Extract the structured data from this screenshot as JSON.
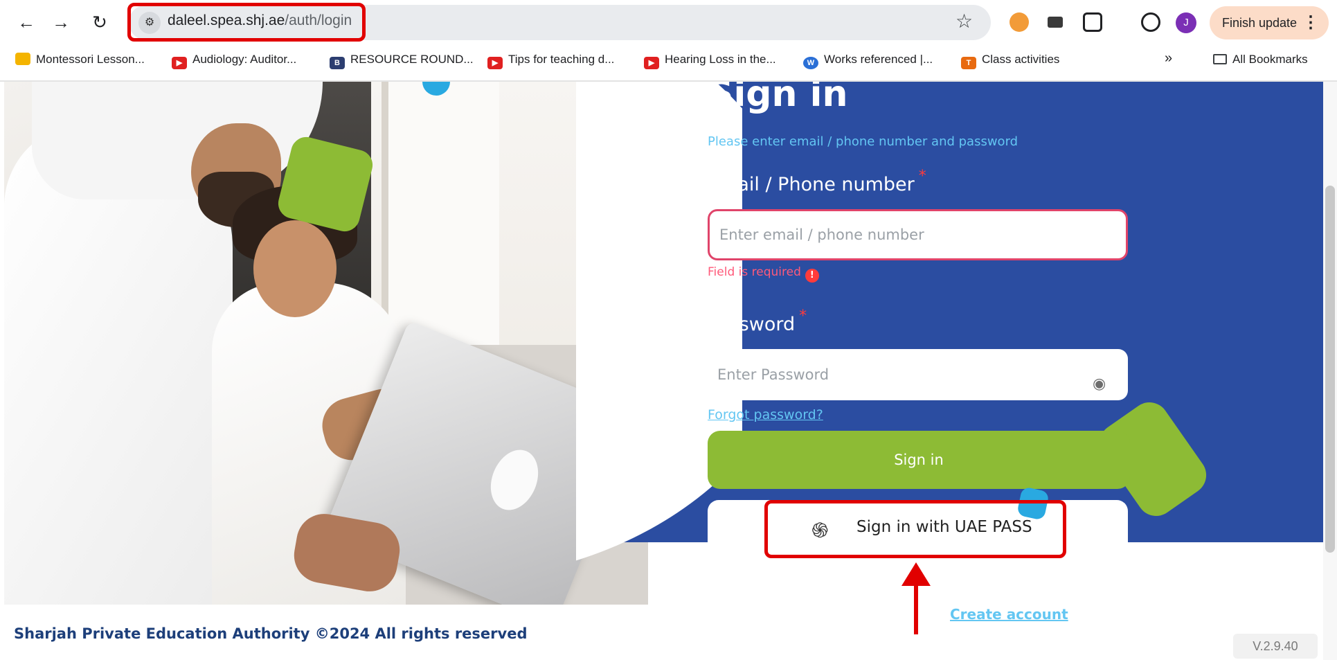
{
  "browser": {
    "url_host": "daleel.spea.shj.ae",
    "url_path": "/auth/login",
    "profile_initial": "J",
    "finish_update_label": "Finish update",
    "bookmarks": [
      {
        "label": "Montessori Lesson...",
        "icon": "montessori-icon",
        "color": "#f4b400"
      },
      {
        "label": "Audiology: Auditor...",
        "icon": "youtube-icon",
        "color": "#e02020"
      },
      {
        "label": "RESOURCE ROUND...",
        "icon": "b-icon",
        "color": "#2c3e70"
      },
      {
        "label": "Tips for teaching d...",
        "icon": "youtube-icon",
        "color": "#e02020"
      },
      {
        "label": "Hearing Loss in the...",
        "icon": "youtube-icon",
        "color": "#e02020"
      },
      {
        "label": "Works referenced |...",
        "icon": "wordpress-icon",
        "color": "#2a6fd6"
      },
      {
        "label": "Class activities",
        "icon": "t-icon",
        "color": "#e86a10"
      }
    ],
    "more_bookmarks": "»",
    "all_bookmarks_label": "All Bookmarks"
  },
  "login": {
    "title": "Sign in",
    "subtitle": "Please enter email / phone number and password",
    "email_label": "Email / Phone number",
    "required_mark": "*",
    "email_placeholder": "Enter email / phone number",
    "email_error": "Field is required",
    "password_label": "Password",
    "password_placeholder": "Enter Password",
    "forgot_password": "Forgot password?",
    "signin_button": "Sign in",
    "uae_pass_button": "Sign in with UAE PASS",
    "create_account": "Create account"
  },
  "footer": {
    "copyright": "Sharjah Private Education Authority ©2024 All rights reserved",
    "version": "V.2.9.40"
  },
  "colors": {
    "panel_blue": "#2b4da1",
    "accent_green": "#8dbb35",
    "accent_cyan": "#63c6f2",
    "annotation_red": "#e10000"
  }
}
